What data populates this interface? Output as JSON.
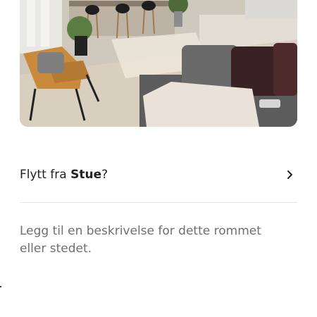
{
  "room_photo": {
    "icon": "living-room-photo"
  },
  "move_row": {
    "prefix": "Flytt fra ",
    "room_name": "Stue",
    "suffix": "?",
    "icon": "chevron-right-icon"
  },
  "description": {
    "placeholder": "Legg til en beskrivelse for dette rommet eller stedet."
  },
  "colors": {
    "text": "#222222",
    "placeholder": "#6f6f6f",
    "divider": "#e6e6e6"
  }
}
